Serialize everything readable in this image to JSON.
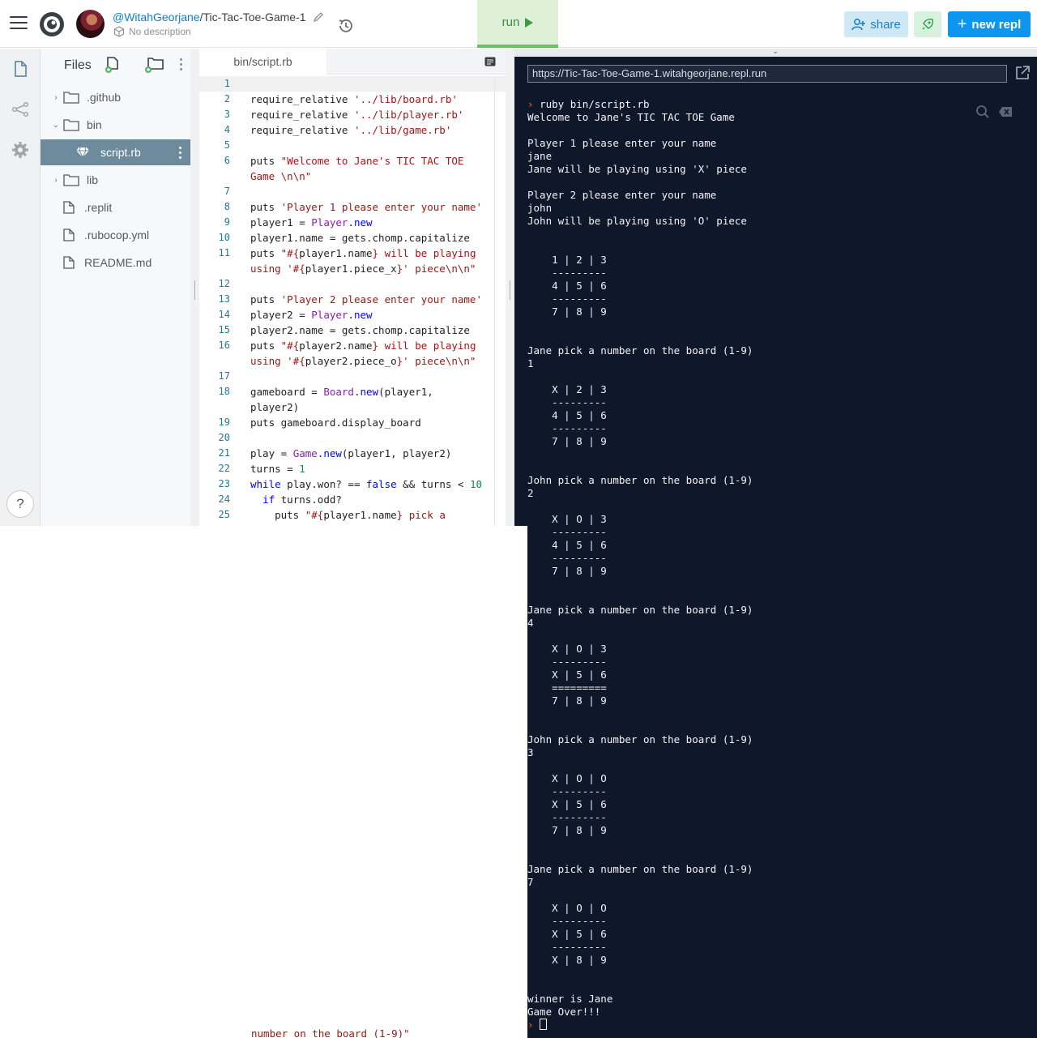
{
  "header": {
    "owner": "@WitahGeorjane",
    "slash": "/",
    "repl_name": "Tic-Tac-Toe-Game-1",
    "description": "No description",
    "run_label": "run",
    "share_label": "share",
    "new_repl_label": "new repl"
  },
  "files_panel": {
    "title": "Files",
    "items": [
      {
        "label": ".github",
        "type": "folder"
      },
      {
        "label": "bin",
        "type": "folder-open"
      },
      {
        "label": "script.rb",
        "type": "file-active"
      },
      {
        "label": "lib",
        "type": "folder"
      },
      {
        "label": ".replit",
        "type": "file"
      },
      {
        "label": ".rubocop.yml",
        "type": "file"
      },
      {
        "label": "README.md",
        "type": "file"
      }
    ]
  },
  "editor": {
    "tab_label": "bin/script.rb",
    "line_numbers": [
      "1",
      "2",
      "3",
      "4",
      "5",
      "6",
      "",
      "7",
      "8",
      "9",
      "10",
      "11",
      "",
      "12",
      "13",
      "14",
      "15",
      "16",
      "",
      "17",
      "18",
      "",
      "19",
      "20",
      "21",
      "22",
      "23",
      "24",
      "25"
    ],
    "bottom_snippet": "number on the board (1-9)\""
  },
  "console": {
    "url": "https://Tic-Tac-Toe-Game-1.witahgeorjane.repl.run",
    "command": "ruby bin/script.rb",
    "output": "Welcome to Jane's TIC TAC TOE Game\n\nPlayer 1 please enter your name\njane\nJane will be playing using 'X' piece\n\nPlayer 2 please enter your name\njohn\nJohn will be playing using 'O' piece\n\n\n    1 | 2 | 3\n    ---------\n    4 | 5 | 6\n    ---------\n    7 | 8 | 9\n\n\nJane pick a number on the board (1-9)\n1\n\n    X | 2 | 3\n    ---------\n    4 | 5 | 6\n    ---------\n    7 | 8 | 9\n\n\nJohn pick a number on the board (1-9)\n2\n\n    X | O | 3\n    ---------\n    4 | 5 | 6\n    ---------\n    7 | 8 | 9\n\n\nJane pick a number on the board (1-9)\n4\n\n    X | O | 3\n    ---------\n    X | 5 | 6\n    =========\n    7 | 8 | 9\n\n\nJohn pick a number on the board (1-9)\n3\n\n    X | O | O\n    ---------\n    X | 5 | 6\n    ---------\n    7 | 8 | 9\n\n\nJane pick a number on the board (1-9)\n7\n\n    X | O | O\n    ---------\n    X | 5 | 6\n    ---------\n    X | 8 | 9\n\n\nwinner is Jane\nGame Over!!!"
  }
}
